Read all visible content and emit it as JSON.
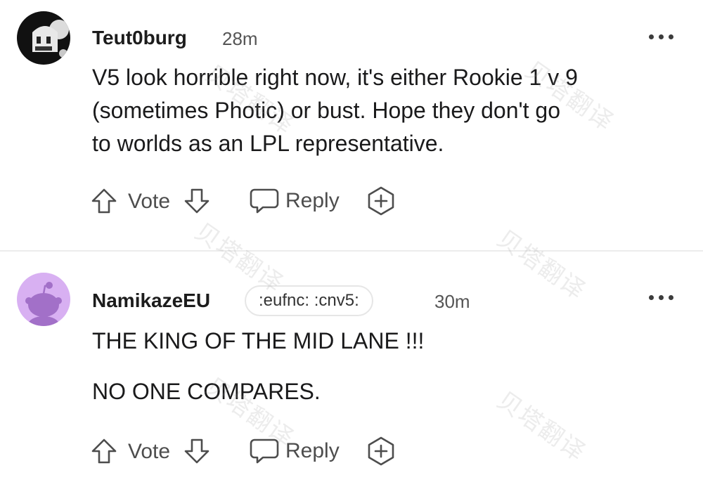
{
  "comments": [
    {
      "username": "Teut0burg",
      "time": "28m",
      "flair": "",
      "body": [
        "V5 look horrible right now, it's either Rookie 1 v 9",
        "(sometimes Photic) or bust. Hope they don't go",
        "to worlds as an LPL representative."
      ],
      "actions": {
        "vote": "Vote",
        "reply": "Reply"
      }
    },
    {
      "username": "NamikazeEU",
      "time": "30m",
      "flair": ":eufnc: :cnv5:",
      "body": [
        "THE KING OF THE MID LANE !!!",
        "NO ONE COMPARES."
      ],
      "actions": {
        "vote": "Vote",
        "reply": "Reply"
      }
    }
  ],
  "watermark": "贝塔翻译",
  "icons": {
    "upvote": "arrow-up-outline-icon",
    "downvote": "arrow-down-outline-icon",
    "reply": "speech-bubble-icon",
    "award": "plus-circle-icon",
    "more": "more-dots-icon"
  },
  "colors": {
    "avatar2_bg": "#d8b0f2",
    "avatar2_fg": "#a270c8",
    "divider": "#ececec"
  }
}
